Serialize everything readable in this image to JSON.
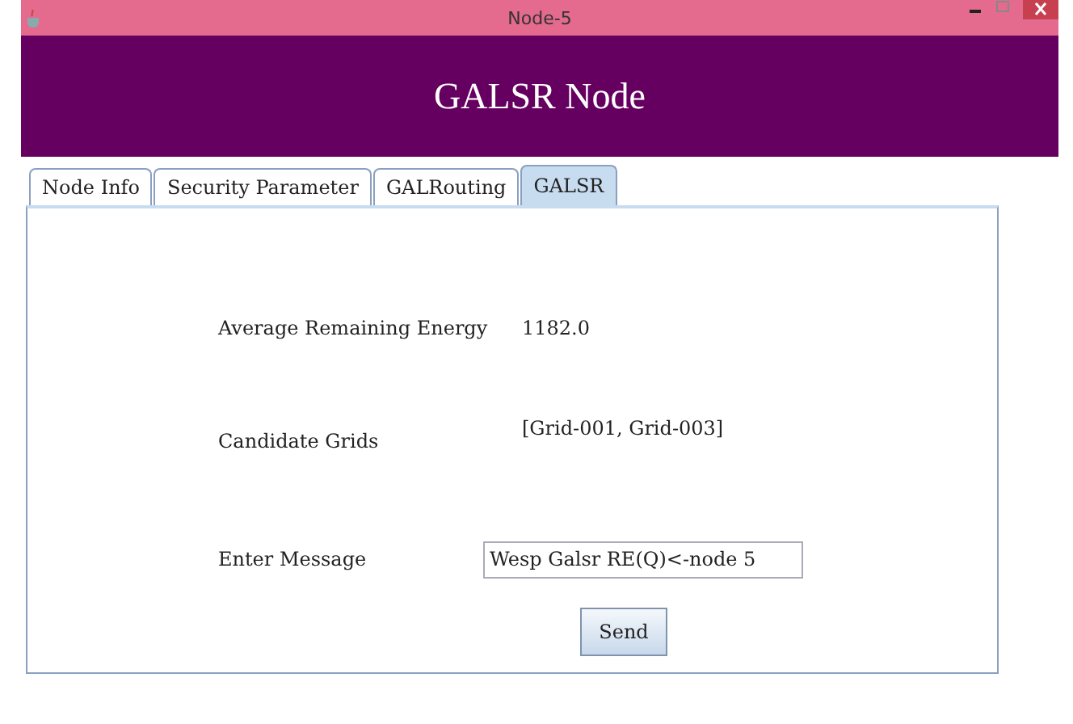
{
  "window": {
    "title": "Node-5"
  },
  "header": {
    "title": "GALSR Node"
  },
  "tabs": [
    {
      "label": "Node Info",
      "selected": false
    },
    {
      "label": "Security Parameter",
      "selected": false
    },
    {
      "label": "GALRouting",
      "selected": false
    },
    {
      "label": "GALSR",
      "selected": true
    }
  ],
  "fields": [
    {
      "label": "Average Remaining Energy",
      "value": "1182.0"
    },
    {
      "label": "Candidate Grids",
      "value": "[Grid-001, Grid-003]"
    }
  ],
  "message": {
    "label": "Enter Message",
    "value": "Wesp Galsr RE(Q)<-node 5"
  },
  "send_button": "Send"
}
